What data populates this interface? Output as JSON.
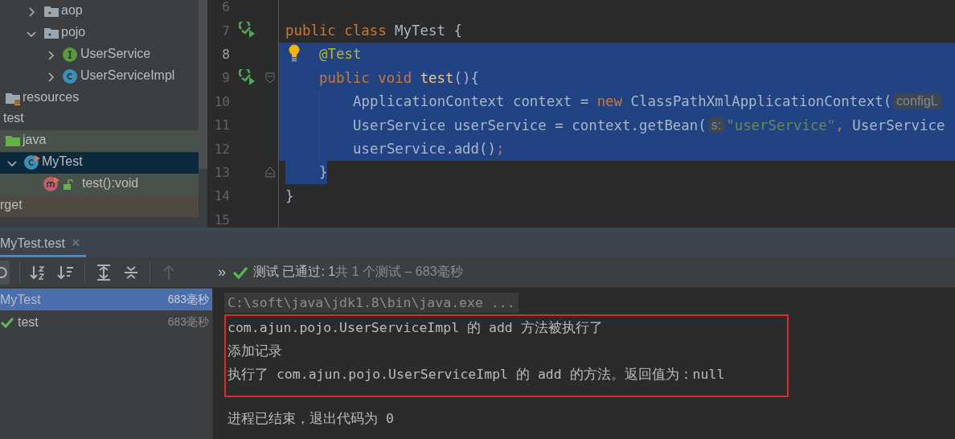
{
  "project_tree": [
    {
      "children": [
        {
          "children": [
            {
              "children": [
                {
                  "children": [
                    {
                      "kind": "package",
                      "label": "aop",
                      "expanded": false,
                      "selected": false
                    },
                    {
                      "kind": "package",
                      "label": "pojo",
                      "expanded": true,
                      "selected": false,
                      "children": [
                        {
                          "kind": "interface",
                          "label": "UserService",
                          "expanded": false,
                          "selected": false
                        },
                        {
                          "kind": "class",
                          "label": "UserServiceImpl",
                          "expanded": false,
                          "selected": false
                        }
                      ]
                    }
                  ]
                }
              ]
            },
            {
              "kind": "resources",
              "label": "resources",
              "selected": false
            }
          ]
        },
        {
          "label": "test",
          "selected": false,
          "children": [
            {
              "kind": "test-source",
              "label": "java",
              "selected": false,
              "test_scope": true,
              "children": [
                {
                  "kind": "test-class",
                  "label": "MyTest",
                  "expanded": true,
                  "selected": true,
                  "children": [
                    {
                      "kind": "method",
                      "label": "test():void",
                      "selected": false,
                      "test_scope": true
                    }
                  ]
                }
              ]
            }
          ]
        }
      ]
    },
    {
      "label": "rget",
      "selected": false,
      "excluded": true
    }
  ],
  "editor": {
    "lines": [
      {
        "number": "6",
        "kind": "blank"
      },
      {
        "number": "7",
        "kind": "class",
        "run_icon": true,
        "tokens": [
          {
            "kind": "kw",
            "text": "public class"
          },
          {
            "kind": "plain",
            "text": " MyTest {"
          }
        ]
      },
      {
        "number": "8",
        "kind": "member",
        "current": true,
        "bulb": true,
        "selected": true,
        "tokens": [
          {
            "kind": "ann",
            "text": "@Test"
          }
        ]
      },
      {
        "number": "9",
        "kind": "member",
        "run_icon": true,
        "fold_start": true,
        "selected": true,
        "tokens": [
          {
            "kind": "kw",
            "text": "public void "
          },
          {
            "kind": "fn",
            "text": "test"
          },
          {
            "kind": "plain",
            "text": "(){"
          }
        ]
      },
      {
        "number": "10",
        "kind": "body",
        "guide": true,
        "selected": true,
        "tokens": [
          {
            "kind": "plain",
            "text": "ApplicationContext context = "
          },
          {
            "kind": "kw",
            "text": "new"
          },
          {
            "kind": "plain",
            "text": " ClassPathXmlApplicationContext("
          },
          {
            "kind": "hint",
            "text": "configL"
          }
        ]
      },
      {
        "number": "11",
        "kind": "body",
        "guide": true,
        "selected": true,
        "tokens": [
          {
            "kind": "plain",
            "text": "UserService userService = context.getBean("
          },
          {
            "kind": "hint",
            "text": "s:"
          },
          {
            "kind": "str",
            "text": "\"userService\""
          },
          {
            "kind": "kw",
            "text": ","
          },
          {
            "kind": "plain",
            "text": " UserService"
          }
        ]
      },
      {
        "number": "12",
        "kind": "body",
        "guide": true,
        "selected": true,
        "tokens": [
          {
            "kind": "plain",
            "text": "userService.add()"
          },
          {
            "kind": "kw",
            "text": ";"
          }
        ]
      },
      {
        "number": "13",
        "kind": "member",
        "fold_end": true,
        "selected": true,
        "selection_ends": true,
        "tokens": [
          {
            "kind": "plain",
            "text": "}"
          }
        ]
      },
      {
        "number": "14",
        "kind": "class",
        "tokens": [
          {
            "kind": "plain",
            "text": "}"
          }
        ]
      },
      {
        "number": "15",
        "kind": "blank"
      }
    ]
  },
  "run_tab": {
    "label": "MyTest.test",
    "close": "×",
    "selected": true
  },
  "toolbar": [
    {
      "kind": "rerun",
      "disabled": false
    },
    {
      "kind": "sort-alpha",
      "disabled": false
    },
    {
      "kind": "sort-duration",
      "disabled": false
    },
    {
      "kind": "expand-all",
      "disabled": false
    },
    {
      "kind": "collapse-all",
      "disabled": false
    },
    {
      "kind": "up",
      "disabled": true
    }
  ],
  "more": "»",
  "status": {
    "passed": true,
    "label": "测试 已通过: 1",
    "summary": "共 1 个测试 – 683毫秒"
  },
  "results": [
    {
      "kind": "suite",
      "name": "MyTest",
      "time": "683毫秒",
      "selected": true
    },
    {
      "kind": "test",
      "name": "test",
      "time": "683毫秒",
      "selected": false,
      "passed": true
    }
  ],
  "console": {
    "command": "C:\\soft\\java\\jdk1.8\\bin\\java.exe ...",
    "highlighted_output": [
      "com.ajun.pojo.UserServiceImpl 的 add 方法被执行了",
      "添加记录",
      "执行了 com.ajun.pojo.UserServiceImpl 的 add 的方法。返回值为：null"
    ],
    "exit": "进程已结束，退出代码为 0"
  }
}
